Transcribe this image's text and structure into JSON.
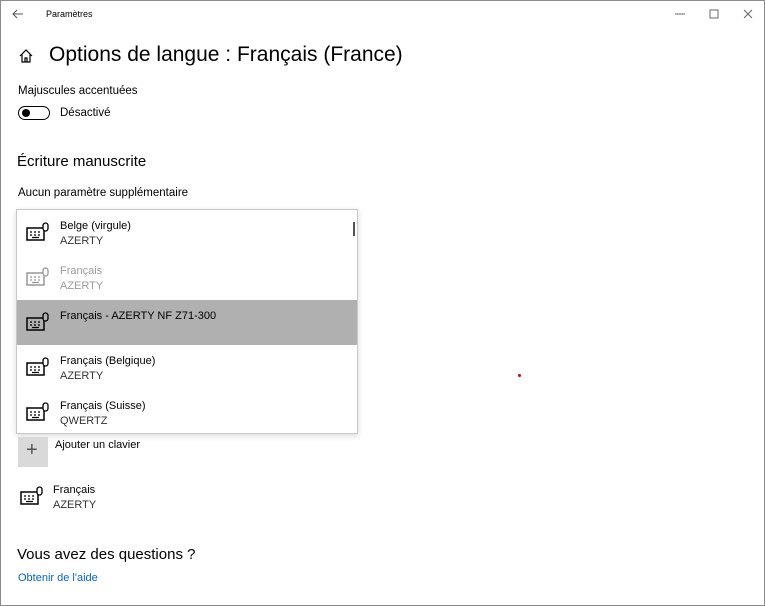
{
  "window": {
    "title": "Paramètres"
  },
  "header": {
    "title": "Options de langue : Français (France)"
  },
  "accent_caps": {
    "label": "Majuscules accentuées",
    "state_text": "Désactivé"
  },
  "handwriting": {
    "heading": "Écriture manuscrite",
    "subtitle": "Aucun paramètre supplémentaire"
  },
  "keyboard_dropdown": {
    "items": [
      {
        "name": "Belge (virgule)",
        "layout": "AZERTY",
        "state": "normal"
      },
      {
        "name": "Français",
        "layout": "AZERTY",
        "state": "disabled"
      },
      {
        "name": "Français - AZERTY NF Z71-300",
        "layout": "",
        "state": "selected"
      },
      {
        "name": "Français (Belgique)",
        "layout": "AZERTY",
        "state": "normal"
      },
      {
        "name": "Français (Suisse)",
        "layout": "QWERTZ",
        "state": "normal"
      }
    ]
  },
  "add_keyboard": {
    "label": "Ajouter un clavier"
  },
  "installed_keyboard": {
    "name": "Français",
    "layout": "AZERTY"
  },
  "help": {
    "heading": "Vous avez des questions ?",
    "link": "Obtenir de l'aide"
  },
  "icons": {
    "back": "back-arrow-icon",
    "home": "home-icon",
    "keyboard": "keyboard-icon",
    "add": "plus-icon",
    "minimize": "minimize-icon",
    "maximize": "maximize-icon",
    "close": "close-icon"
  },
  "colors": {
    "selected_row": "#b0b0b0",
    "link": "#0066cc",
    "disabled_text": "#9a9a9a"
  }
}
